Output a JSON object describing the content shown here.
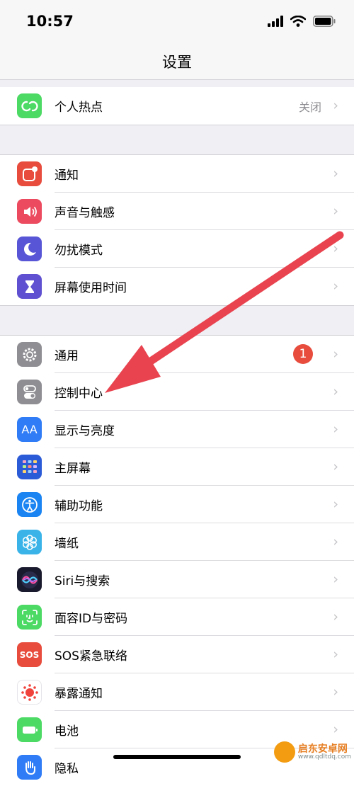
{
  "status": {
    "time": "10:57"
  },
  "nav": {
    "title": "设置"
  },
  "rows": [
    {
      "label": "个人热点",
      "value": "关闭",
      "icon": "hotspot-icon",
      "color": "#4cd964"
    },
    {
      "label": "通知",
      "icon": "notification-icon",
      "color": "#e74c3c"
    },
    {
      "label": "声音与触感",
      "icon": "speaker-icon",
      "color": "#ec4a5e"
    },
    {
      "label": "勿扰模式",
      "icon": "moon-icon",
      "color": "#5856d6"
    },
    {
      "label": "屏幕使用时间",
      "icon": "hourglass-icon",
      "color": "#5e50d0"
    },
    {
      "label": "通用",
      "badge": "1",
      "icon": "gear-icon",
      "color": "#8e8e93"
    },
    {
      "label": "控制中心",
      "icon": "toggle-icon",
      "color": "#8e8e93"
    },
    {
      "label": "显示与亮度",
      "icon": "text-size-icon",
      "color": "#2f7cf6"
    },
    {
      "label": "主屏幕",
      "icon": "home-grid-icon",
      "color": "#2c5bd7"
    },
    {
      "label": "辅助功能",
      "icon": "accessibility-icon",
      "color": "#1a84f2"
    },
    {
      "label": "墙纸",
      "icon": "flower-icon",
      "color": "#3ab4e8"
    },
    {
      "label": "Siri与搜索",
      "icon": "siri-icon",
      "color": "#1a1a2e"
    },
    {
      "label": "面容ID与密码",
      "icon": "face-id-icon",
      "color": "#4cd964"
    },
    {
      "label": "SOS紧急联络",
      "icon": "sos-icon",
      "color": "#e74c3c"
    },
    {
      "label": "暴露通知",
      "icon": "exposure-icon",
      "color": "#ffffff"
    },
    {
      "label": "电池",
      "icon": "battery-icon",
      "color": "#4cd964"
    },
    {
      "label": "隐私",
      "icon": "privacy-hand-icon",
      "color": "#2f7cf6"
    }
  ],
  "icon_text": {
    "text_size": "AA",
    "sos": "SOS"
  },
  "annotation": {
    "arrow_color": "#e8434f"
  },
  "watermark": {
    "title": "启东安卓网",
    "url": "www.qdltdq.com"
  }
}
